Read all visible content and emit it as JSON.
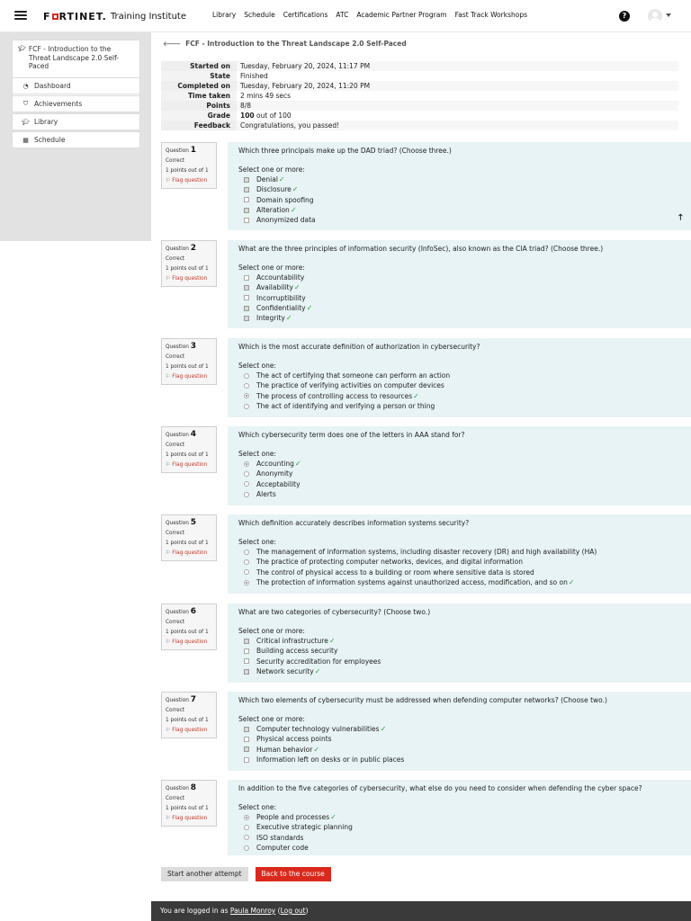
{
  "header": {
    "logo_brand_1": "F",
    "logo_brand_red": "",
    "logo_brand_2": "RTINET.",
    "logo_sub": "Training Institute",
    "nav": [
      "Library",
      "Schedule",
      "Certifications",
      "ATC",
      "Academic Partner Program",
      "Fast Track Workshops"
    ],
    "help_glyph": "?"
  },
  "sidebar": {
    "course_title": "FCF - Introduction to the Threat Landscape 2.0 Self-Paced",
    "items": [
      {
        "label": "Dashboard",
        "icon": "dashboard-icon"
      },
      {
        "label": "Achievements",
        "icon": "shield-icon"
      },
      {
        "label": "Library",
        "icon": "graduation-cap-icon"
      },
      {
        "label": "Schedule",
        "icon": "calendar-icon"
      }
    ]
  },
  "breadcrumb": "FCF - Introduction to the Threat Landscape 2.0 Self-Paced",
  "summary": [
    {
      "k": "Started on",
      "v": "Tuesday, February 20, 2024, 11:17 PM"
    },
    {
      "k": "State",
      "v": "Finished"
    },
    {
      "k": "Completed on",
      "v": "Tuesday, February 20, 2024, 11:20 PM"
    },
    {
      "k": "Time taken",
      "v": "2 mins 49 secs"
    },
    {
      "k": "Points",
      "v": "8/8"
    },
    {
      "k": "Grade",
      "v_bold": "100",
      "v": " out of 100"
    },
    {
      "k": "Feedback",
      "v": "Congratulations, you passed!"
    }
  ],
  "question_meta": {
    "question_word": "Question",
    "status": "Correct",
    "points": "1 points out of 1",
    "flag": "Flag question"
  },
  "questions": [
    {
      "num": "1",
      "text": "Which three principals make up the DAD triad? (Choose three.)",
      "prompt": "Select one or more:",
      "kind": "check",
      "options": [
        {
          "t": "Denial",
          "c": true
        },
        {
          "t": "Disclosure",
          "c": true
        },
        {
          "t": "Domain spoofing",
          "c": false
        },
        {
          "t": "Alteration",
          "c": true
        },
        {
          "t": "Anonymized data",
          "c": false
        }
      ]
    },
    {
      "num": "2",
      "text": "What are the three principles of information security (InfoSec), also known as the CIA triad? (Choose three.)",
      "prompt": "Select one or more:",
      "kind": "check",
      "options": [
        {
          "t": "Accountability",
          "c": false
        },
        {
          "t": "Availability",
          "c": true
        },
        {
          "t": "Incorruptibility",
          "c": false
        },
        {
          "t": "Confidentiality",
          "c": true
        },
        {
          "t": "Integrity",
          "c": true
        }
      ]
    },
    {
      "num": "3",
      "text": "Which is the most accurate definition of authorization in cybersecurity?",
      "prompt": "Select one:",
      "kind": "radio",
      "options": [
        {
          "t": "The act of certifying that someone can perform an action",
          "c": false
        },
        {
          "t": "The practice of verifying activities on computer devices",
          "c": false
        },
        {
          "t": "The process of controlling access to resources",
          "c": true
        },
        {
          "t": "The act of identifying and verifying a person or thing",
          "c": false
        }
      ]
    },
    {
      "num": "4",
      "text": "Which cybersecurity term does one of the letters in AAA stand for?",
      "prompt": "Select one:",
      "kind": "radio",
      "options": [
        {
          "t": "Accounting",
          "c": true
        },
        {
          "t": "Anonymity",
          "c": false
        },
        {
          "t": "Acceptability",
          "c": false
        },
        {
          "t": "Alerts",
          "c": false
        }
      ]
    },
    {
      "num": "5",
      "text": "Which definition accurately describes information systems security?",
      "prompt": "Select one:",
      "kind": "radio",
      "options": [
        {
          "t": "The management of information systems, including disaster recovery (DR) and high availability (HA)",
          "c": false
        },
        {
          "t": "The practice of protecting computer networks, devices, and digital information",
          "c": false
        },
        {
          "t": "The control of physical access to a building or room where sensitive data is stored",
          "c": false
        },
        {
          "t": "The protection of information systems against unauthorized access, modification, and so on",
          "c": true
        }
      ]
    },
    {
      "num": "6",
      "text": "What are two categories of cybersecurity? (Choose two.)",
      "prompt": "Select one or more:",
      "kind": "check",
      "options": [
        {
          "t": "Critical infrastructure",
          "c": true
        },
        {
          "t": "Building access security",
          "c": false
        },
        {
          "t": "Security accreditation for employees",
          "c": false
        },
        {
          "t": "Network security",
          "c": true
        }
      ]
    },
    {
      "num": "7",
      "text": "Which two elements of cybersecurity must be addressed when defending computer networks? (Choose two.)",
      "prompt": "Select one or more:",
      "kind": "check",
      "options": [
        {
          "t": "Computer technology vulnerabilities",
          "c": true
        },
        {
          "t": "Physical access points",
          "c": false
        },
        {
          "t": "Human behavior",
          "c": true
        },
        {
          "t": "Information left on desks or in public places",
          "c": false
        }
      ]
    },
    {
      "num": "8",
      "text": "In addition to the five categories of cybersecurity, what else do you need to consider when defending the cyber space?",
      "prompt": "Select one:",
      "kind": "radio",
      "options": [
        {
          "t": "People and processes",
          "c": true
        },
        {
          "t": "Executive strategic planning",
          "c": false
        },
        {
          "t": "ISO standards",
          "c": false
        },
        {
          "t": "Computer code",
          "c": false
        }
      ]
    }
  ],
  "buttons": {
    "start_another": "Start another attempt",
    "back": "Back to the course"
  },
  "footer": {
    "prefix": "You are logged in as ",
    "user": "Paula Monroy",
    "open": " (",
    "logout": "Log out",
    "close": ")"
  },
  "colors": {
    "brand_red": "#da291c",
    "correct_green": "#2e9d3e",
    "question_bg": "#e7f3f5"
  }
}
